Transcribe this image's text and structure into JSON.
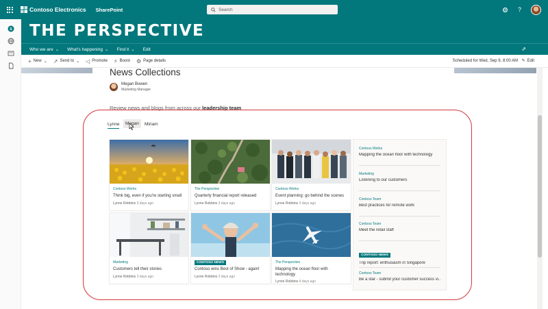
{
  "suite": {
    "org_name": "Contoso Electronics",
    "app_name": "SharePoint",
    "search_placeholder": "Search",
    "help_label": "?"
  },
  "hub": {
    "title": "THE PERSPECTIVE",
    "nav": [
      {
        "label": "Who we are",
        "has_menu": true
      },
      {
        "label": "What's happening",
        "has_menu": true
      },
      {
        "label": "Find it",
        "has_menu": true
      },
      {
        "label": "Edit",
        "has_menu": false
      }
    ]
  },
  "commands": {
    "new": "New",
    "send_to": "Send to",
    "promote": "Promote",
    "boost": "Boost",
    "page_details": "Page details",
    "scheduled": "Scheduled for Wed, Sep 9, 8:00 AM",
    "edit": "Edit"
  },
  "page": {
    "title": "News Collections",
    "author_name": "Megan Bowen",
    "author_role": "Marketing Manager",
    "description_prefix": "Review news and blogs from across our ",
    "description_bold": "leadership team"
  },
  "tabs": [
    {
      "label": "Lynne",
      "active": true
    },
    {
      "label": "Megan",
      "active": false
    },
    {
      "label": "Miriam",
      "active": false
    }
  ],
  "cards": [
    {
      "category": "Contoso Works",
      "badge": false,
      "title": "Think big, even if you're starting small",
      "author": "Lynne Robbins",
      "date": "3 days ago",
      "image": "sunflower-field"
    },
    {
      "category": "The Perspective",
      "badge": false,
      "title": "Quarterly financial report released",
      "author": "Lynne Robbins",
      "date": "3 days ago",
      "image": "aerial-forest-road"
    },
    {
      "category": "Contoso Works",
      "badge": false,
      "title": "Event planning: go behind the scenes",
      "author": "Lynne Robbins",
      "date": "3 days ago",
      "image": "team-group"
    },
    {
      "category": "Marketing",
      "badge": false,
      "title": "Customers tell their stories",
      "author": "Lynne Robbins",
      "date": "3 days ago",
      "image": "office-room"
    },
    {
      "category": "CONTOSO NEWS",
      "badge": true,
      "title": "Contoso wins Best of Show - again!",
      "author": "Lynne Robbins",
      "date": "3 days ago",
      "image": "excited-woman"
    },
    {
      "category": "The Perspective",
      "badge": false,
      "title": "Mapping the ocean floor with technology",
      "author": "Lynne Robbins",
      "date": "4 days ago",
      "image": "plane-over-ocean"
    }
  ],
  "side_list": [
    {
      "category": "Contoso Works",
      "badge": false,
      "title": "Mapping the ocean floor with technology"
    },
    {
      "category": "Marketing",
      "badge": false,
      "title": "Listening to our customers"
    },
    {
      "category": "Contoso Team",
      "badge": false,
      "title": "Best practices for remote work"
    },
    {
      "category": "Contoso Team",
      "badge": false,
      "title": "Meet the retail staff"
    },
    {
      "category": "CONTOSO NEWS",
      "badge": true,
      "title": "Trip report: enthusiasm in Singapore"
    },
    {
      "category": "Contoso Team",
      "badge": false,
      "title": "Be a star - submit your customer success vi..."
    }
  ],
  "colors": {
    "brand": "#03787c",
    "highlight": "#d1363c"
  }
}
